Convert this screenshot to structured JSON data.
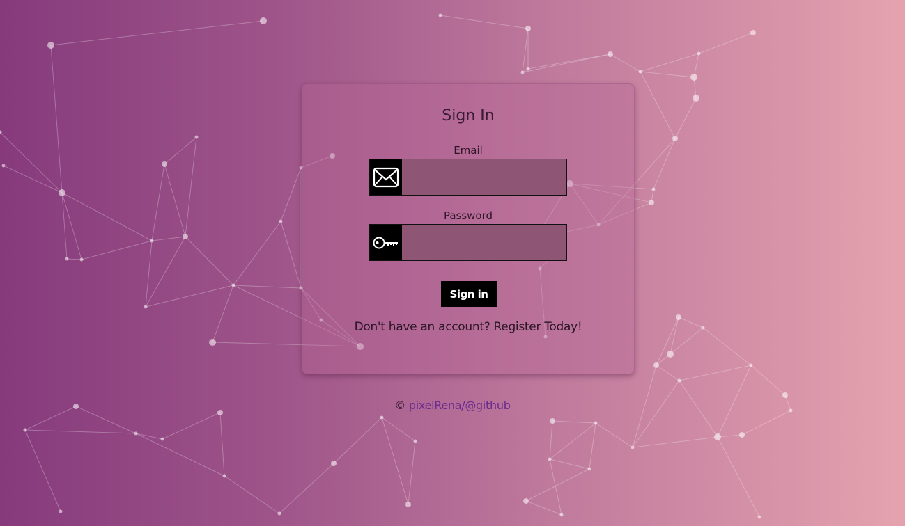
{
  "login": {
    "title": "Sign In",
    "email_label": "Email",
    "email_value": "",
    "email_icon": "envelope-icon",
    "password_label": "Password",
    "password_value": "",
    "password_icon": "key-icon",
    "submit_label": "Sign in",
    "register_text": "Don't have an account? Register Today!"
  },
  "footer": {
    "copyright_symbol": "©",
    "link_text": "pixelRena/@github"
  },
  "colors": {
    "gradient_start": "#863a7c",
    "gradient_end": "#e5a2ae",
    "button_bg": "#000000",
    "input_bg": "#8e5574",
    "footer_link": "#6a2a8e"
  }
}
